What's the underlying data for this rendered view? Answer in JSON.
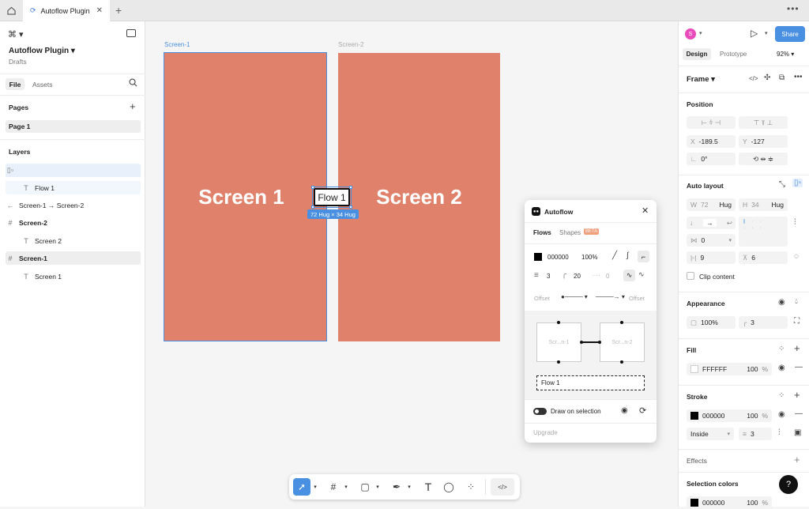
{
  "tabs": {
    "home_icon": "home-icon",
    "active_tab": "Autoflow Plugin"
  },
  "file": {
    "name": "Autoflow Plugin",
    "location": "Drafts"
  },
  "left_tabs": [
    "File",
    "Assets"
  ],
  "pages": {
    "header": "Pages",
    "items": [
      "Page 1"
    ]
  },
  "layers": {
    "header": "Layers",
    "items": [
      {
        "name": "",
        "icon": "autolayout-icon"
      },
      {
        "name": "Flow 1",
        "icon": "text-icon"
      },
      {
        "name": "Screen-1 → Screen-2",
        "icon": "arrow-left-icon"
      },
      {
        "name": "Screen-2",
        "icon": "frame-icon"
      },
      {
        "name": "Screen 2",
        "icon": "text-icon"
      },
      {
        "name": "Screen-1",
        "icon": "frame-icon"
      },
      {
        "name": "Screen 1",
        "icon": "text-icon"
      }
    ]
  },
  "canvas": {
    "frame1_label": "Screen-1",
    "frame1_text": "Screen 1",
    "frame2_label": "Screen-2",
    "frame2_text": "Screen 2",
    "flow_label": "Flow 1",
    "size_badge": "72 Hug × 34 Hug",
    "frame_color": "#e0826b",
    "selection_color": "#4a90e2"
  },
  "plugin": {
    "title": "Autoflow",
    "tabs": [
      "Flows",
      "Shapes"
    ],
    "beta": "BETA",
    "color_hex": "000000",
    "opacity": "100%",
    "stroke_width": "3",
    "corner_radius": "20",
    "dash": "0",
    "offset_left": "Offset",
    "offset_right": "Offset",
    "node1": "Scr...n-1",
    "node2": "Scr...n-2",
    "flow_name": "Flow 1",
    "draw_on_selection": "Draw on selection",
    "upgrade": "Upgrade"
  },
  "right": {
    "avatar": "S",
    "share": "Share",
    "tabs": [
      "Design",
      "Prototype"
    ],
    "zoom": "92%",
    "frame_label": "Frame",
    "position": "Position",
    "x": "-189.5",
    "y": "-127",
    "rotation": "0°",
    "auto_layout": "Auto layout",
    "w": "72",
    "w_mode": "Hug",
    "h": "34",
    "h_mode": "Hug",
    "gap": "0",
    "padding_h": "9",
    "padding_v": "6",
    "clip": "Clip content",
    "appearance": "Appearance",
    "opacity": "100%",
    "radius": "3",
    "fill": "Fill",
    "fill_hex": "FFFFFF",
    "fill_opacity": "100",
    "fill_pct": "%",
    "stroke": "Stroke",
    "stroke_hex": "000000",
    "stroke_opacity": "100",
    "stroke_pct": "%",
    "stroke_align": "Inside",
    "stroke_weight": "3",
    "effects": "Effects",
    "selection_colors": "Selection colors",
    "sel_hex": "000000",
    "sel_opacity": "100",
    "sel_pct": "%"
  },
  "toolbar": {
    "tools": [
      "move-tool",
      "frame-tool",
      "shape-tool",
      "pen-tool",
      "text-tool",
      "comment-tool",
      "actions-tool",
      "dev-mode-toggle"
    ]
  }
}
